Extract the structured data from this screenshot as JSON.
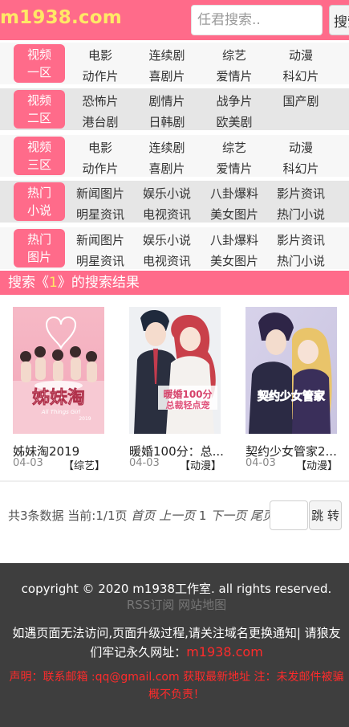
{
  "header": {
    "logo": "m1938.com",
    "search_placeholder": "任君搜索..",
    "search_button": "搜索"
  },
  "nav": [
    {
      "label_line1": "视频",
      "label_line2": "一区",
      "links": [
        "电影",
        "连续剧",
        "综艺",
        "动漫",
        "动作片",
        "喜剧片",
        "爱情片",
        "科幻片"
      ]
    },
    {
      "label_line1": "视频",
      "label_line2": "二区",
      "links": [
        "恐怖片",
        "剧情片",
        "战争片",
        "国产剧",
        "港台剧",
        "日韩剧",
        "欧美剧"
      ]
    },
    {
      "label_line1": "视频",
      "label_line2": "三区",
      "links": [
        "电影",
        "连续剧",
        "综艺",
        "动漫",
        "动作片",
        "喜剧片",
        "爱情片",
        "科幻片"
      ]
    },
    {
      "label_line1": "热门",
      "label_line2": "小说",
      "links": [
        "新闻图片",
        "娱乐小说",
        "八卦爆料",
        "影片资讯",
        "明星资讯",
        "电视资讯",
        "美女图片",
        "热门小说"
      ]
    },
    {
      "label_line1": "热门",
      "label_line2": "图片",
      "links": [
        "新闻图片",
        "娱乐小说",
        "八卦爆料",
        "影片资讯",
        "明星资讯",
        "电视资讯",
        "美女图片",
        "热门小说"
      ]
    }
  ],
  "results": {
    "prefix": "搜索《",
    "keyword": "1",
    "suffix": "》的搜索结果"
  },
  "items": [
    {
      "title": "姊妹淘2019",
      "date": "04-03",
      "category": "【综艺】",
      "poster_text": "姊妹淘",
      "poster_sub": "All Things Girl",
      "poster_year": "2019"
    },
    {
      "title": "暖婚100分：总...",
      "date": "04-03",
      "category": "【动漫】",
      "poster_text": "暖婚100分",
      "poster_sub": "总裁轻点宠"
    },
    {
      "title": "契约少女管家2...",
      "date": "04-03",
      "category": "【动漫】",
      "poster_text": "契约少女管家"
    }
  ],
  "pager": {
    "summary": "共3条数据 当前:1/1页",
    "first": "首页",
    "prev": "上一页",
    "current": "1",
    "next": "下一页",
    "last": "尾页",
    "jump": "跳 转"
  },
  "footer": {
    "copyright": "copyright © 2020 m1938工作室. all rights reserved.",
    "rss": "RSS订阅",
    "sitemap": "网站地图",
    "notice": "如遇页面无法访问,页面升级过程,请关注域名更换通知| 请狼友们牢记永久网址：",
    "domain": "m1938.com",
    "disclaimer": "声明：联系邮箱 :qq@gmail.com 获取最新地址 注：未发邮件被骗概不负责！"
  },
  "colors": {
    "brand_pink": "#ff6b8a",
    "logo_yellow": "#ffe866",
    "footer_bg": "#3e3e3e",
    "warning_red": "#ff2b2b"
  }
}
